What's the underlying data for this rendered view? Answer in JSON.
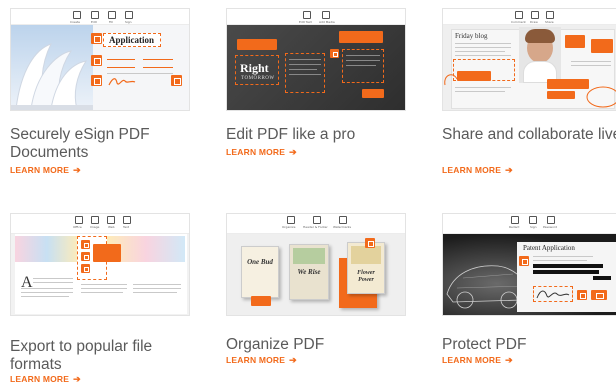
{
  "cards": [
    {
      "title": "Securely eSign PDF Documents",
      "link": "LEARN MORE",
      "thumb": {
        "toolbar": [
          "Create",
          "Edit",
          "Fill",
          "Sign"
        ],
        "field_label": "Application"
      }
    },
    {
      "title": "Edit PDF like a pro",
      "link": "LEARN MORE",
      "thumb": {
        "toolbar": [
          "Edit Text",
          "Add Media"
        ],
        "headline": "Right",
        "subheadline": "TOMORROW"
      }
    },
    {
      "title": "Share and collaborate live",
      "link": "LEARN MORE",
      "thumb": {
        "toolbar": [
          "Comment",
          "Draw",
          "Share"
        ],
        "heading": "Friday blog"
      }
    },
    {
      "title": "Export to popular file formats",
      "link": "LEARN MORE",
      "thumb": {
        "toolbar": [
          "Office",
          "Image",
          "Web",
          "Text"
        ]
      }
    },
    {
      "title": "Organize PDF",
      "link": "LEARN MORE",
      "thumb": {
        "toolbar": [
          "Organize",
          "Header & Footer",
          "Watermarks"
        ],
        "poster_text": [
          "One Bud",
          "We Rise",
          "Flower Power"
        ]
      }
    },
    {
      "title": "Protect PDF",
      "link": "LEARN MORE",
      "thumb": {
        "toolbar": [
          "Redact",
          "Sign",
          "Password"
        ],
        "heading": "Patent Application"
      }
    }
  ],
  "colors": {
    "accent": "#f26a1b",
    "title": "#5a5a5a",
    "border": "#e3e3e3"
  },
  "icons": [
    "arrow-right-icon",
    "pdf-toolbar-icon"
  ]
}
